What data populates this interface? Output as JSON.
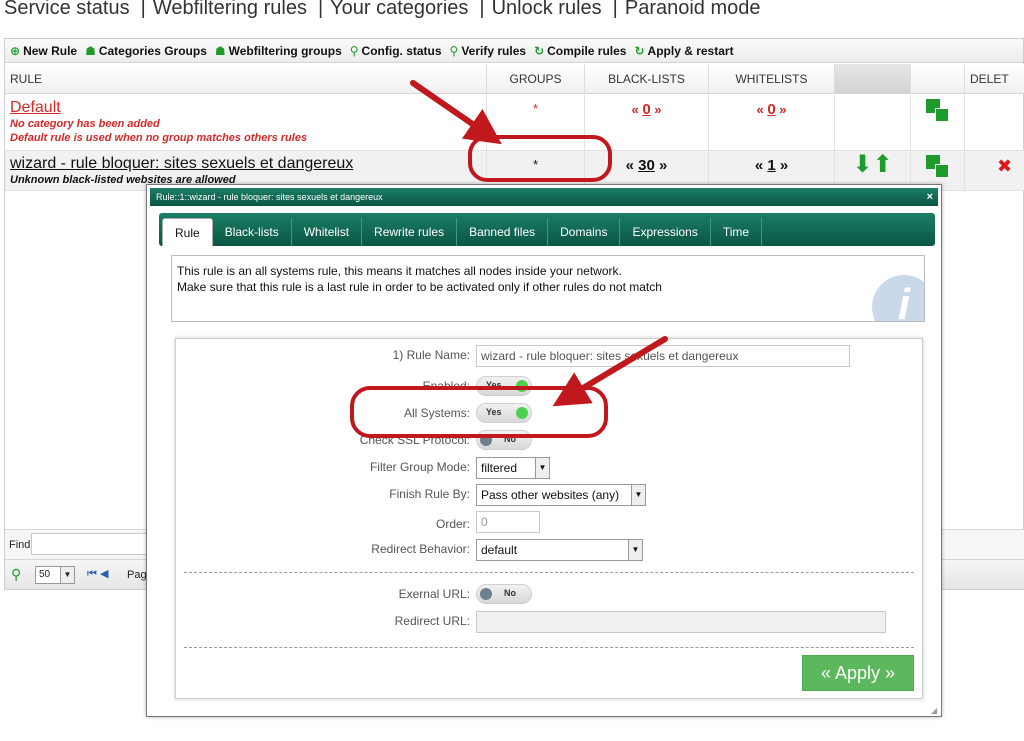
{
  "topnav": {
    "links": [
      "Service status",
      "Webfiltering rules",
      "Your categories",
      "Unlock rules",
      "Paranoid mode"
    ],
    "separator": "|"
  },
  "toolbar": {
    "items": [
      {
        "icon": "plus-circle-icon",
        "label": "New Rule"
      },
      {
        "icon": "users-icon",
        "label": "Categories Groups"
      },
      {
        "icon": "users-icon",
        "label": "Webfiltering groups"
      },
      {
        "icon": "search-icon",
        "label": "Config. status"
      },
      {
        "icon": "search-icon",
        "label": "Verify rules"
      },
      {
        "icon": "refresh-icon",
        "label": "Compile rules"
      },
      {
        "icon": "refresh-icon",
        "label": "Apply & restart"
      }
    ]
  },
  "table": {
    "headers": {
      "rule": "RULE",
      "groups": "GROUPS",
      "blacklists": "BLACK-LISTS",
      "whitelists": "WHITELISTS",
      "delete": "DELET"
    },
    "rows": [
      {
        "title": "Default",
        "notes": [
          "No category has been added",
          "Default rule is used when no group matches others rules"
        ],
        "groups": "*",
        "black_open": "«",
        "black_value": "0",
        "black_close": "»",
        "white_open": "«",
        "white_value": "0",
        "white_close": "»"
      },
      {
        "title": "wizard - rule bloquer: sites sexuels et dangereux",
        "notes": [
          "Unknown black-listed websites are allowed"
        ],
        "groups": "*",
        "black_open": "«",
        "black_value": "30",
        "black_close": "»",
        "white_open": "«",
        "white_value": "1",
        "white_close": "»"
      }
    ]
  },
  "find": {
    "label": "Find"
  },
  "pager": {
    "per_page": "50",
    "page_label": "Page"
  },
  "modal": {
    "title": "Rule::1::wizard - rule bloquer: sites sexuels et dangereux",
    "close": "×",
    "tabs": [
      "Rule",
      "Black-lists",
      "Whitelist",
      "Rewrite rules",
      "Banned files",
      "Domains",
      "Expressions",
      "Time"
    ],
    "active_tab": "Rule",
    "info_lines": [
      "This rule is an all systems rule, this means it matches all nodes inside your network.",
      "Make sure that this rule is a last rule in order to be activated only if other rules do not match"
    ],
    "form": {
      "rule_name_label": "1) Rule Name:",
      "rule_name_value": "wizard - rule bloquer: sites sexuels et dangereux",
      "enabled_label": "Enabled:",
      "enabled_value": "Yes",
      "all_systems_label": "All Systems:",
      "all_systems_value": "Yes",
      "ssl_label": "Check SSL Protocol:",
      "ssl_value": "No",
      "filter_mode_label": "Filter Group Mode:",
      "filter_mode_value": "filtered",
      "finish_label": "Finish Rule By:",
      "finish_value": "Pass other websites (any)",
      "order_label": "Order:",
      "order_placeholder": "0",
      "redirect_behavior_label": "Redirect Behavior:",
      "redirect_behavior_value": "default",
      "external_url_label": "Exernal URL:",
      "external_url_value": "No",
      "redirect_url_label": "Redirect URL:"
    },
    "apply_label": "« Apply »"
  },
  "colors": {
    "accent_green": "#1f9a2c",
    "modal_teal": "#0a5644",
    "annotation_red": "#c0181d",
    "apply_green": "#5cb85c"
  }
}
